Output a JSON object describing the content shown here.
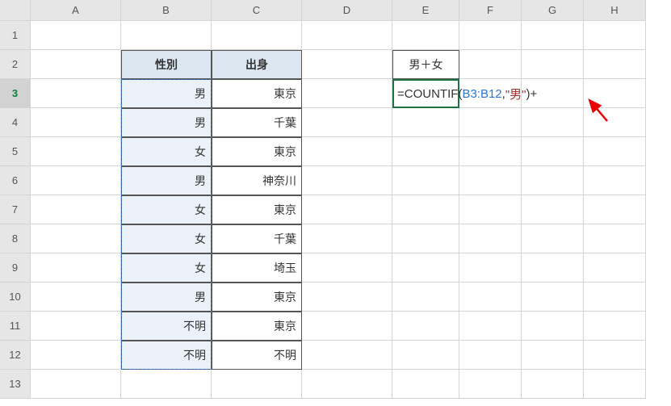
{
  "columns": [
    "A",
    "B",
    "C",
    "D",
    "E",
    "F",
    "G",
    "H"
  ],
  "rows": [
    "1",
    "2",
    "3",
    "4",
    "5",
    "6",
    "7",
    "8",
    "9",
    "10",
    "11",
    "12",
    "13"
  ],
  "active_row": "3",
  "headers": {
    "b": "性別",
    "c": "出身"
  },
  "label_e2": "男＋女",
  "data": [
    {
      "b": "男",
      "c": "東京"
    },
    {
      "b": "男",
      "c": "千葉"
    },
    {
      "b": "女",
      "c": "東京"
    },
    {
      "b": "男",
      "c": "神奈川"
    },
    {
      "b": "女",
      "c": "東京"
    },
    {
      "b": "女",
      "c": "千葉"
    },
    {
      "b": "女",
      "c": "埼玉"
    },
    {
      "b": "男",
      "c": "東京"
    },
    {
      "b": "不明",
      "c": "東京"
    },
    {
      "b": "不明",
      "c": "不明"
    }
  ],
  "formula": {
    "eq": "=",
    "fn": "COUNTIF",
    "open": "(",
    "ref": "B3:B12",
    "comma": ",",
    "str": "\"男\"",
    "close": ")",
    "plus": "+"
  }
}
